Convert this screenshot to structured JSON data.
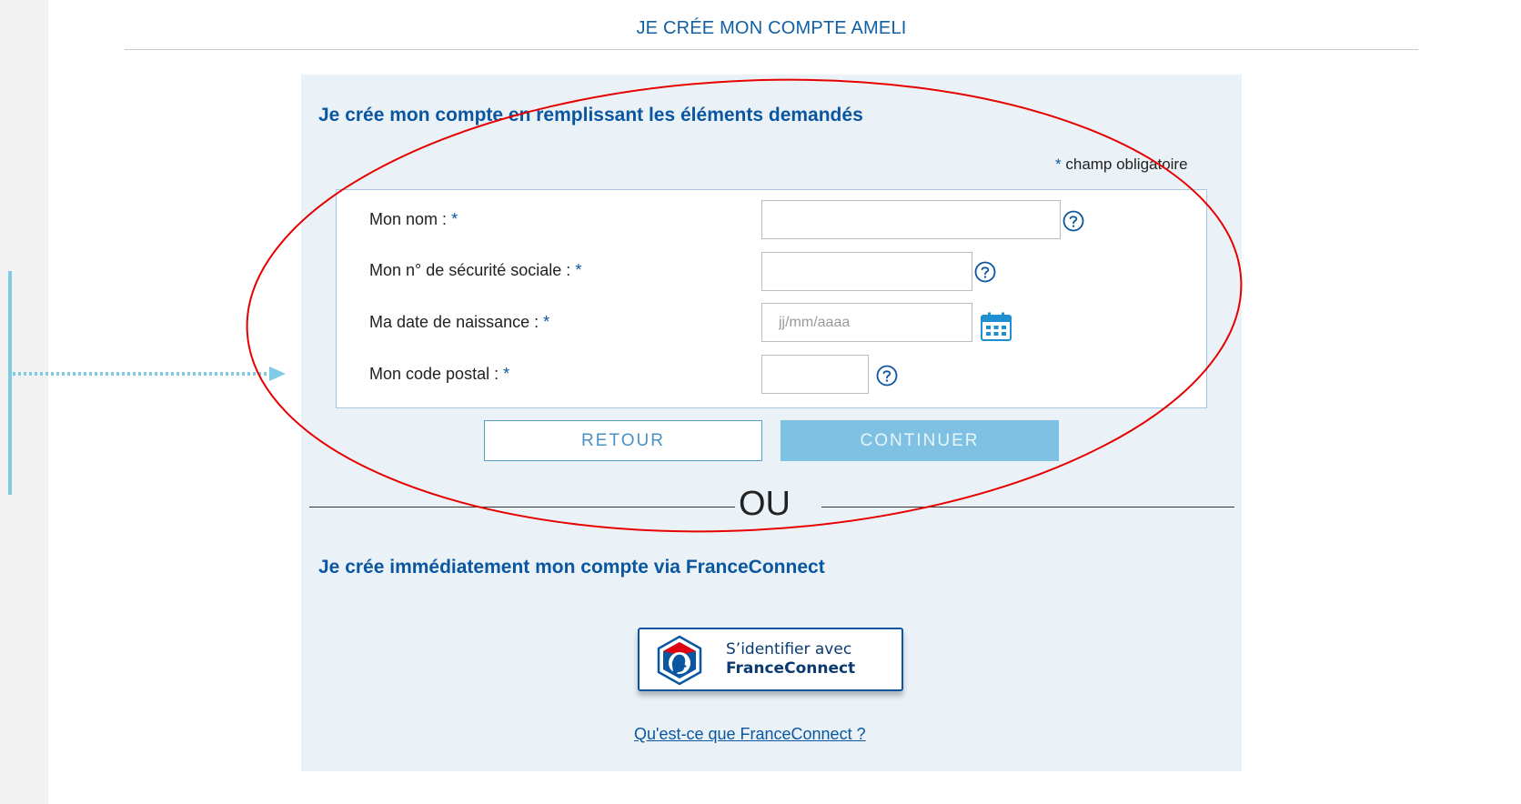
{
  "page": {
    "title": "JE CRÉE MON COMPTE AMELI"
  },
  "form_section": {
    "heading": "Je crée mon compte en remplissant les éléments demandés",
    "required_note_star": "*",
    "required_note": "champ obligatoire",
    "fields": [
      {
        "label": "Mon nom :",
        "star": "*",
        "value": "",
        "placeholder": "",
        "icon": "help-icon"
      },
      {
        "label": "Mon n° de sécurité sociale :",
        "star": "*",
        "value": "",
        "placeholder": "",
        "icon": "help-icon"
      },
      {
        "label": "Ma date de naissance :",
        "star": "*",
        "value": "",
        "placeholder": "jj/mm/aaaa",
        "icon": "calendar-icon"
      },
      {
        "label": "Mon code postal :",
        "star": "*",
        "value": "",
        "placeholder": "",
        "icon": "help-icon"
      }
    ],
    "back_button": "RETOUR",
    "continue_button": "CONTINUER"
  },
  "separator": {
    "text": "OU"
  },
  "franceconnect_section": {
    "heading": "Je crée immédiatement mon compte via FranceConnect",
    "button_line1": "S’identifier avec",
    "button_line2": "FranceConnect",
    "link": "Qu'est-ce que FranceConnect ?"
  },
  "colors": {
    "brand_blue": "#0b56a0",
    "panel_bg": "#eaf2f7",
    "continue_disabled": "#7fc1e3",
    "annotation_red": "#e60000",
    "annotation_cyan": "#7fcbe6"
  }
}
